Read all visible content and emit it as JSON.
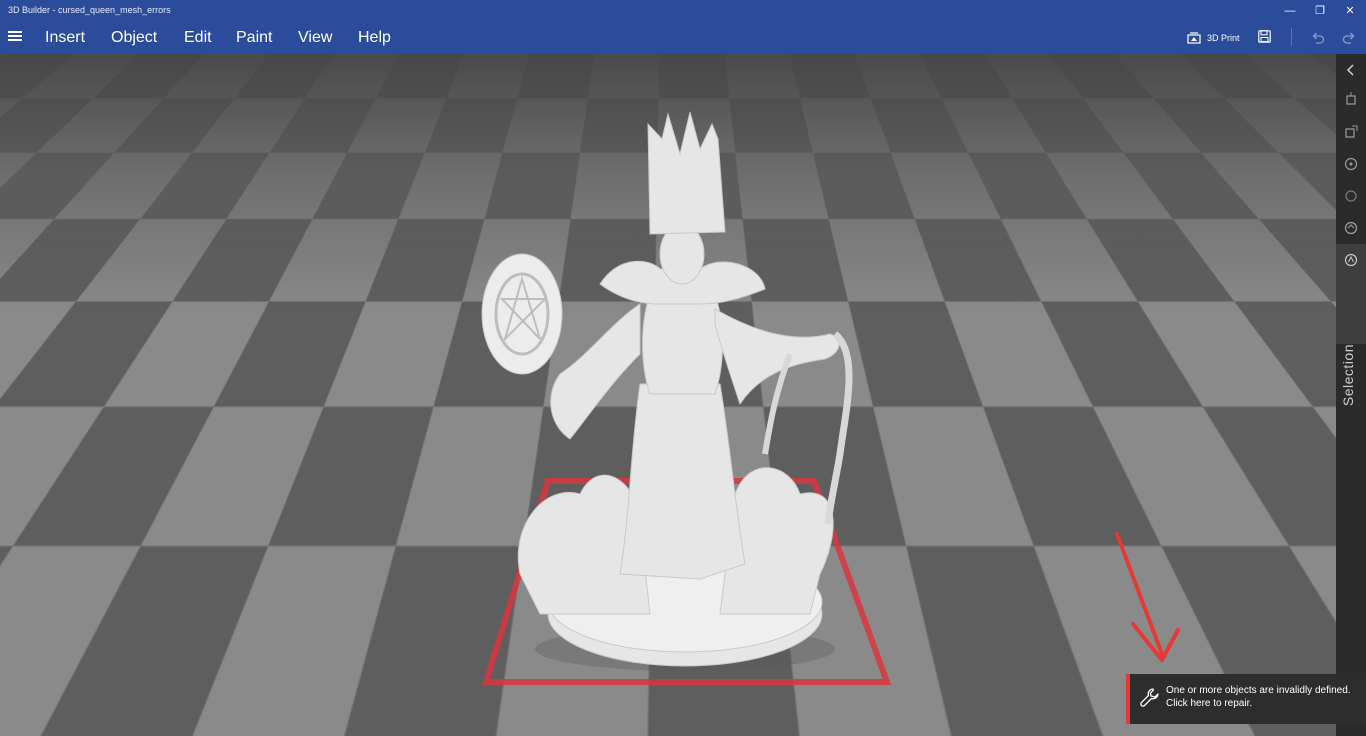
{
  "window": {
    "title": "3D Builder - cursed_queen_mesh_errors",
    "controls": {
      "minimize": "—",
      "restore": "❐",
      "close": "✕"
    }
  },
  "menu": {
    "items": [
      "Insert",
      "Object",
      "Edit",
      "Paint",
      "View",
      "Help"
    ]
  },
  "toolbar": {
    "print_label": "3D Print"
  },
  "sidepanel": {
    "label": "Selection",
    "icons": [
      "collapse-chevron-icon",
      "move-icon",
      "scale-icon",
      "rotate-icon",
      "circle-icon",
      "lay-flat-icon",
      "selection-icon"
    ]
  },
  "notification": {
    "line1": "One or more objects are invalidly defined.",
    "line2": "Click here to repair."
  },
  "colors": {
    "header": "#2b4b9b",
    "alert": "#e53935",
    "bed_outline": "#d9363e",
    "model": "#e6e6e6"
  }
}
